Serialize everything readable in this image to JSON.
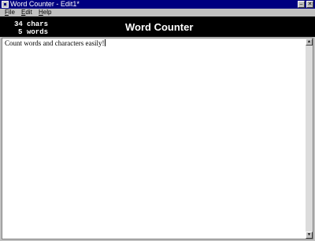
{
  "window": {
    "title": "Word Counter - Edit1*",
    "minimize_glyph": "‒",
    "close_glyph": "✕"
  },
  "menu": {
    "items": [
      {
        "first": "F",
        "rest": "ile"
      },
      {
        "first": "E",
        "rest": "dit"
      },
      {
        "first": "H",
        "rest": "elp"
      }
    ]
  },
  "header": {
    "char_count": "34",
    "char_label": "chars",
    "word_count": "5",
    "word_label": "words",
    "title": "Word Counter"
  },
  "editor": {
    "text": "Count words and characters easily!"
  },
  "scrollbar": {
    "up_glyph": "▲",
    "down_glyph": "▼"
  },
  "colors": {
    "titlebar": "#000080",
    "header_bg": "#000000",
    "window_bg": "#c0c0c0"
  }
}
